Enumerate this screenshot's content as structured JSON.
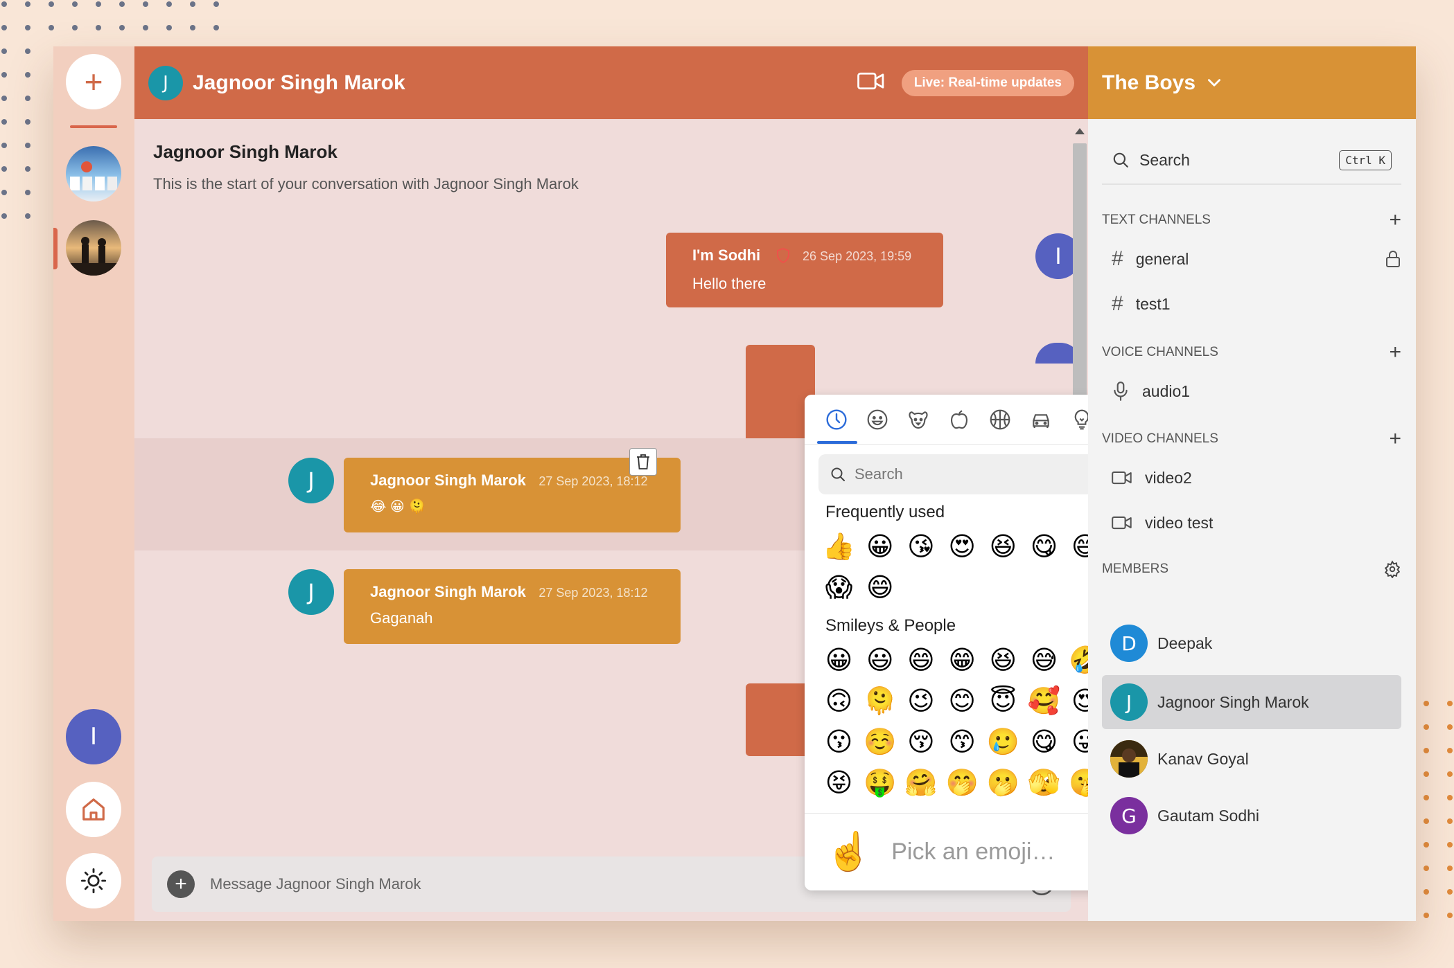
{
  "colors": {
    "header_accent": "#d06a48",
    "server_header": "#d89236",
    "own_message": "#d06a48",
    "other_message": "#d89236",
    "avatar_teal": "#1a96a8",
    "avatar_indigo": "#5661c0",
    "avatar_blue": "#1f8ad6",
    "avatar_purple": "#7a2f9e"
  },
  "rail": {
    "add_label": "+",
    "user_avatar_letter": "I"
  },
  "chat": {
    "header": {
      "avatar_letter": "J",
      "title": "Jagnoor Singh Marok",
      "video_icon": "video-camera-icon",
      "live_badge": "Live: Real-time updates"
    },
    "intro": {
      "title": "Jagnoor Singh Marok",
      "subtitle": "This is the start of your conversation with Jagnoor Singh Marok"
    },
    "messages": [
      {
        "author": "I'm Sodhi",
        "timestamp": "26 Sep 2023, 19:59",
        "text": "Hello there",
        "avatar_letter": "I",
        "badge_icon": "shield-icon"
      },
      {
        "author": "Jagnoor Singh Marok",
        "timestamp": "27 Sep 2023, 18:12",
        "text": "😂 😀 🫠",
        "avatar_letter": "J"
      },
      {
        "author": "Jagnoor Singh Marok",
        "timestamp": "27 Sep 2023, 18:12",
        "text": "Gaganah",
        "avatar_letter": "J"
      }
    ],
    "composer": {
      "placeholder": "Message Jagnoor Singh  Marok"
    }
  },
  "emoji_picker": {
    "categories": [
      "recent-icon",
      "smiley-icon",
      "animal-icon",
      "food-icon",
      "sports-icon",
      "travel-icon",
      "objects-icon",
      "symbols-icon",
      "flags-icon"
    ],
    "search_placeholder": "Search",
    "sections": [
      {
        "title": "Frequently used",
        "emojis": [
          "👍",
          "😀",
          "😘",
          "😍",
          "😆",
          "😋",
          "😅",
          "😂",
          "😁",
          "😱",
          "😄"
        ]
      },
      {
        "title": "Smileys & People",
        "emojis": [
          "😀",
          "😃",
          "😄",
          "😁",
          "😆",
          "😅",
          "🤣",
          "😂",
          "🙂",
          "🙃",
          "🫠",
          "😉",
          "😊",
          "😇",
          "🥰",
          "😍",
          "🤩",
          "😘",
          "😗",
          "☺️",
          "😚",
          "😙",
          "🥲",
          "😋",
          "😛",
          "😜",
          "🤪",
          "😝",
          "🤑",
          "🤗",
          "🤭",
          "🫢",
          "🫣",
          "🤫",
          "🤔",
          "🫡"
        ]
      }
    ],
    "footer": {
      "preview_emoji": "☝️",
      "prompt": "Pick an emoji…"
    }
  },
  "sidebar": {
    "server_name": "The Boys",
    "search": {
      "label": "Search",
      "shortcut": "Ctrl K"
    },
    "text_channels": {
      "title": "TEXT CHANNELS",
      "items": [
        {
          "name": "general",
          "locked": true
        },
        {
          "name": "test1",
          "locked": false
        }
      ]
    },
    "voice_channels": {
      "title": "VOICE CHANNELS",
      "items": [
        {
          "name": "audio1"
        }
      ]
    },
    "video_channels": {
      "title": "VIDEO CHANNELS",
      "items": [
        {
          "name": "video2"
        },
        {
          "name": "video test"
        }
      ]
    },
    "members": {
      "title": "MEMBERS",
      "items": [
        {
          "name": "Deepak",
          "letter": "D"
        },
        {
          "name": "Jagnoor Singh Marok",
          "letter": "J",
          "active": true
        },
        {
          "name": "Kanav Goyal",
          "letter": ""
        },
        {
          "name": "Gautam Sodhi",
          "letter": "G"
        }
      ]
    }
  }
}
